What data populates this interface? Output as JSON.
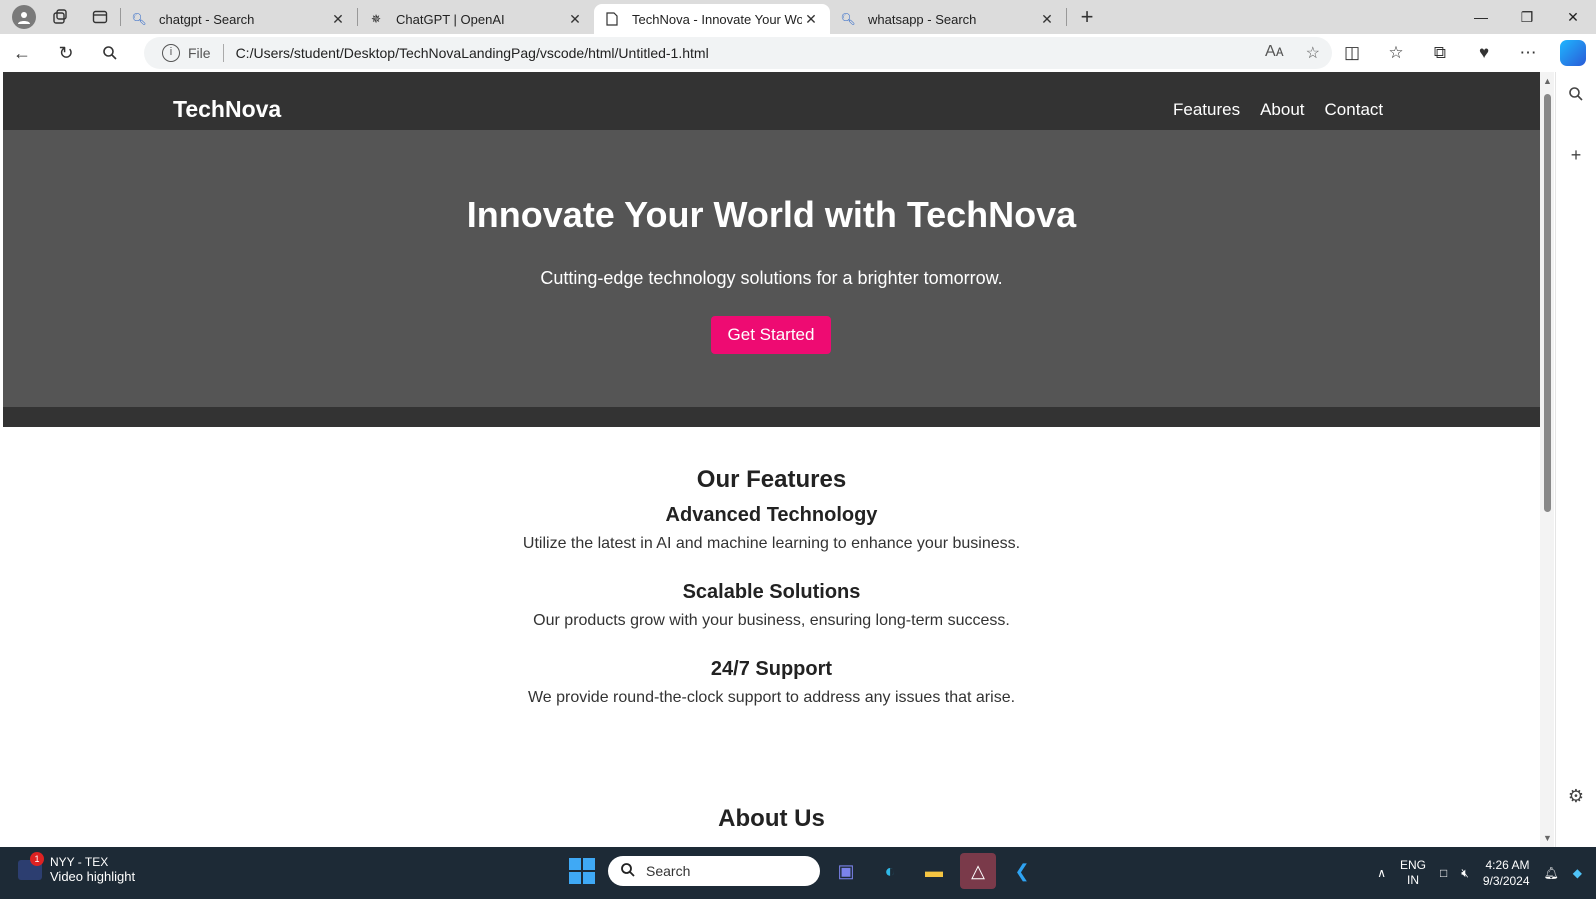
{
  "browser": {
    "tabs": [
      {
        "label": "chatgpt - Search",
        "icon": "search-icon"
      },
      {
        "label": "ChatGPT | OpenAI",
        "icon": "openai-icon"
      },
      {
        "label": "TechNova - Innovate Your World",
        "icon": "page-icon"
      },
      {
        "label": "whatsapp - Search",
        "icon": "search-icon"
      }
    ],
    "address": {
      "scheme_label": "File",
      "url": "C:/Users/student/Desktop/TechNovaLandingPag/vscode/html/Untitled-1.html"
    }
  },
  "site": {
    "brand": "TechNova",
    "nav": [
      "Features",
      "About",
      "Contact"
    ],
    "hero": {
      "title": "Innovate Your World with TechNova",
      "subtitle": "Cutting-edge technology solutions for a brighter tomorrow.",
      "cta": "Get Started"
    },
    "features": {
      "title": "Our Features",
      "items": [
        {
          "title": "Advanced Technology",
          "desc": "Utilize the latest in AI and machine learning to enhance your business."
        },
        {
          "title": "Scalable Solutions",
          "desc": "Our products grow with your business, ensuring long-term success."
        },
        {
          "title": "24/7 Support",
          "desc": "We provide round-the-clock support to address any issues that arise."
        }
      ]
    },
    "about_title": "About Us"
  },
  "taskbar": {
    "news": {
      "title": "NYY - TEX",
      "subtitle": "Video highlight",
      "badge": "1"
    },
    "search_placeholder": "Search",
    "lang": {
      "line1": "ENG",
      "line2": "IN"
    },
    "time": "4:26 AM",
    "date": "9/3/2024"
  },
  "colors": {
    "header": "#333333",
    "hero": "#555555",
    "cta": "#ee0b72"
  }
}
